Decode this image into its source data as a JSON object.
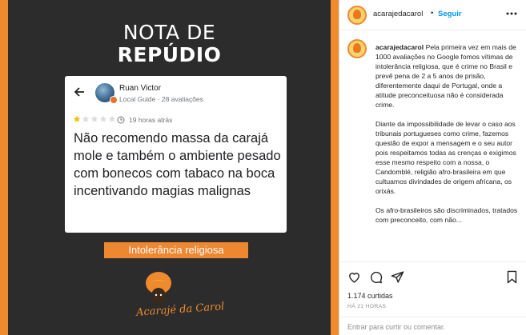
{
  "post_image": {
    "headline_line1": "NOTA DE",
    "headline_line2": "REPÚDIO",
    "review": {
      "reviewer_name": "Ruan Victor",
      "reviewer_meta": "Local Guide · 28 avaliações",
      "rating": 1,
      "max_rating": 5,
      "time": "19 horas atrás",
      "text": "Não recomendo massa da carajá mole e também o ambiente pesado com bonecos com tabaco na boca incentivando magias malignas"
    },
    "label": "Intolerância religiosa",
    "brand": "Acarajé da Carol",
    "colors": {
      "background": "#2c2c2c",
      "accent": "#ef8a2d",
      "star_filled": "#fbbc04",
      "star_empty": "#dadce0"
    }
  },
  "header": {
    "username": "acarajedacarol",
    "separator": "•",
    "follow_label": "Seguir",
    "more_icon": "more-horizontal-icon"
  },
  "caption": {
    "username": "acarajedacarol",
    "paragraphs": [
      "Pela primeira vez em mais de 1000 avaliações no Google fomos vítimas de intolerância religiosa, que é crime no Brasil e prevê pena de 2 a 5 anos de prisão, diferentemente daqui de Portugal, onde a atitude preconceituosa não é considerada crime.",
      "Diante da impossibilidade de levar o caso aos tribunais portugueses como crime, fazemos questão de expor a mensagem e o seu autor pois respeitamos todas as crenças e exigimos esse mesmo respeito com a nossa, o Candomblé, religião afro-brasileira em que cultuamos divindades de origem africana, os orixás.",
      "Os afro-brasileiros são discriminados, tratados com preconceito, com não..."
    ]
  },
  "actions": {
    "icons": [
      "heart-icon",
      "comment-icon",
      "share-icon",
      "bookmark-icon"
    ],
    "likes": "1.174 curtidas",
    "date": "HÁ 21 HORAS"
  },
  "comment": {
    "placeholder": "Entrar para curtir ou comentar."
  }
}
